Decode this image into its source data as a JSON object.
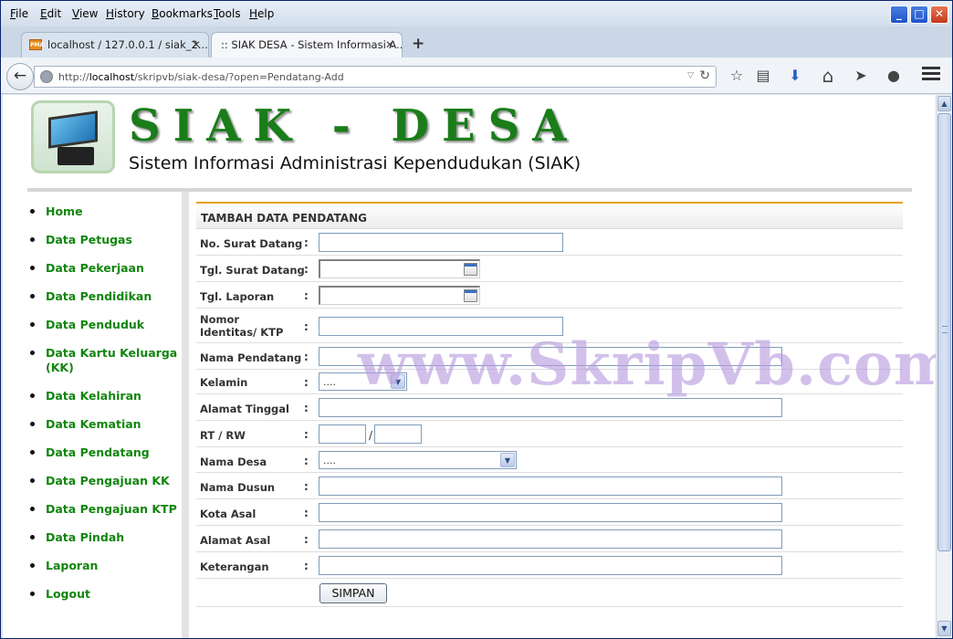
{
  "menubar": {
    "items": [
      {
        "label": "File",
        "accesskey": "F",
        "rest": "ile"
      },
      {
        "label": "Edit",
        "accesskey": "E",
        "rest": "dit"
      },
      {
        "label": "View",
        "accesskey": "V",
        "rest": "iew"
      },
      {
        "label": "History",
        "accesskey": "H",
        "rest": "istory"
      },
      {
        "label": "Bookmarks",
        "accesskey": "B",
        "rest": "ookmarks"
      },
      {
        "label": "Tools",
        "accesskey": "T",
        "rest": "ools"
      },
      {
        "label": "Help",
        "accesskey": "H",
        "rest": "elp"
      }
    ],
    "window_buttons": {
      "minimize": "_",
      "maximize": "□",
      "close": "✕"
    }
  },
  "tabs": [
    {
      "title": "localhost / 127.0.0.1 / siak_2...",
      "favicon": "PMA",
      "close": "✕"
    },
    {
      "title": ":: SIAK DESA - Sistem Informasi A...",
      "close": "✕"
    }
  ],
  "new_tab_label": "+",
  "navbar": {
    "url_prefix": "http://",
    "url_host": "localhost",
    "url_path": "/skripvb/siak-desa/?open=Pendatang-Add",
    "dropdown_glyph": "▽",
    "reload_glyph": "↻",
    "back_glyph": "←",
    "icons": [
      {
        "name": "bookmark-star-icon",
        "glyph": "☆"
      },
      {
        "name": "reading-list-icon",
        "glyph": "▤"
      },
      {
        "name": "download-icon",
        "glyph": "⬇"
      },
      {
        "name": "home-icon",
        "glyph": "⌂"
      },
      {
        "name": "send-icon",
        "glyph": "➤"
      },
      {
        "name": "chat-icon",
        "glyph": "●"
      }
    ]
  },
  "header": {
    "title": "SIAK - DESA",
    "subtitle": "Sistem Informasi Administrasi Kependudukan (SIAK)"
  },
  "sidebar": {
    "items": [
      "Home",
      "Data Petugas",
      "Data Pekerjaan",
      "Data Pendidikan",
      "Data Penduduk",
      "Data Kartu Keluarga (KK)",
      "Data Kelahiran",
      "Data Kematian",
      "Data Pendatang",
      "Data Pengajuan KK",
      "Data Pengajuan KTP",
      "Data Pindah",
      "Laporan",
      "Logout"
    ]
  },
  "form": {
    "heading": "TAMBAH DATA PENDATANG",
    "colon": ":",
    "rows": [
      {
        "label": "No. Surat Datang",
        "type": "text",
        "value": ""
      },
      {
        "label": "Tgl. Surat Datang",
        "type": "date",
        "value": ""
      },
      {
        "label": "Tgl. Laporan",
        "type": "date",
        "value": ""
      },
      {
        "label": "Nomor Identitas/ KTP",
        "type": "text",
        "value": ""
      },
      {
        "label": "Nama Pendatang",
        "type": "text",
        "value": ""
      },
      {
        "label": "Kelamin",
        "type": "select",
        "value": "...."
      },
      {
        "label": "Alamat Tinggal",
        "type": "text",
        "value": ""
      },
      {
        "label": "RT / RW",
        "type": "rtrw",
        "value": "",
        "separator": "/"
      },
      {
        "label": "Nama Desa",
        "type": "select",
        "value": "...."
      },
      {
        "label": "Nama Dusun",
        "type": "text",
        "value": ""
      },
      {
        "label": "Kota Asal",
        "type": "text",
        "value": ""
      },
      {
        "label": "Alamat Asal",
        "type": "text",
        "value": ""
      },
      {
        "label": "Keterangan",
        "type": "text",
        "value": ""
      }
    ],
    "submit_label": "SIMPAN"
  },
  "watermark": "www.SkripVb.com",
  "colors": {
    "accent_green": "#12850f",
    "title_green": "#1a7d1a",
    "panel_topline": "#e8a21a",
    "watermark": "#b79adf"
  }
}
